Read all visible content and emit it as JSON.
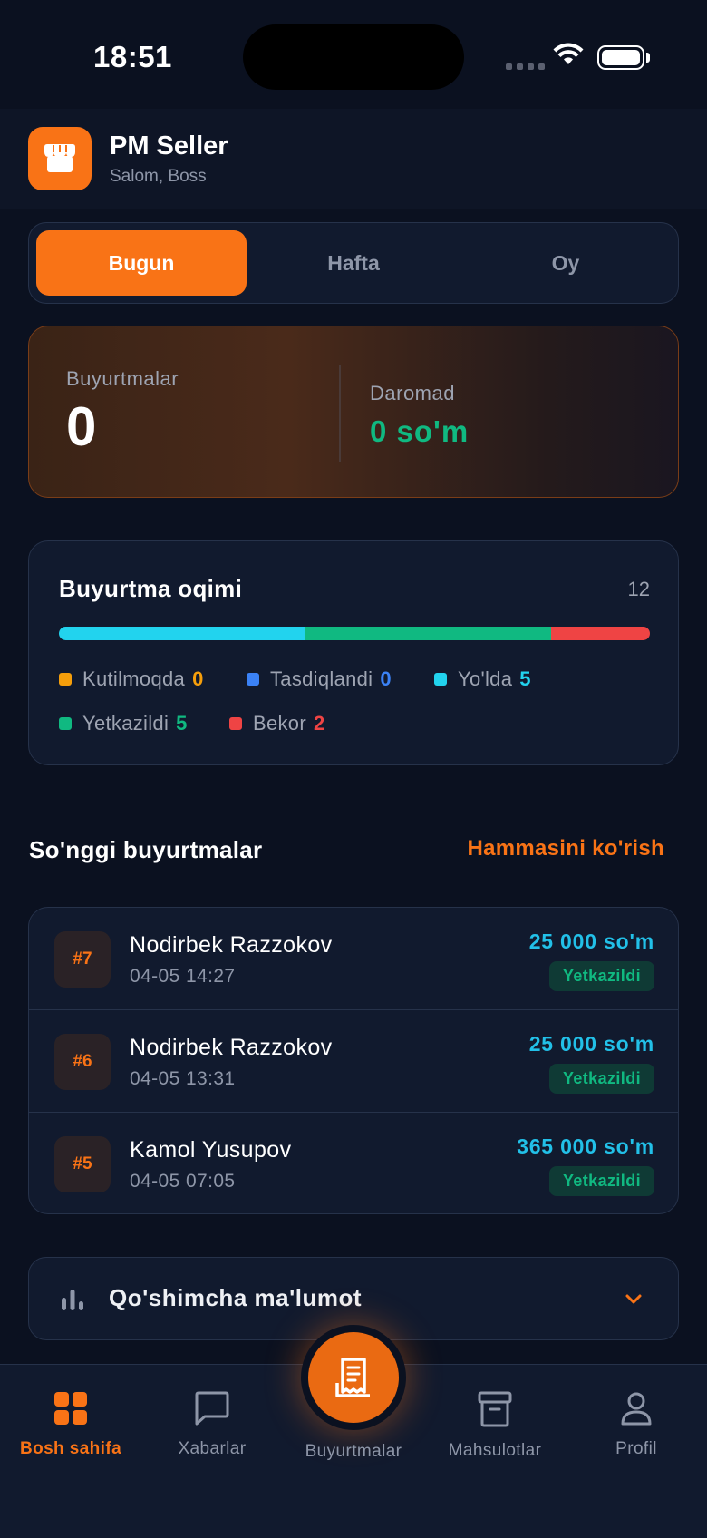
{
  "status_bar": {
    "time": "18:51"
  },
  "header": {
    "app_name": "PM Seller",
    "greeting": "Salom, Boss",
    "logo_icon": "store-icon"
  },
  "period_tabs": [
    {
      "label": "Bugun",
      "active": true
    },
    {
      "label": "Hafta",
      "active": false
    },
    {
      "label": "Oy",
      "active": false
    }
  ],
  "summary": {
    "orders_label": "Buyurtmalar",
    "orders_value": "0",
    "income_label": "Daromad",
    "income_value": "0 so'm"
  },
  "order_flow": {
    "title": "Buyurtma oqimi",
    "total": "12",
    "statuses": [
      {
        "label": "Kutilmoqda",
        "count": "0",
        "color": "#f59e0b"
      },
      {
        "label": "Tasdiqlandi",
        "count": "0",
        "color": "#3b82f6"
      },
      {
        "label": "Yo'lda",
        "count": "5",
        "color": "#22d3ee"
      },
      {
        "label": "Yetkazildi",
        "count": "5",
        "color": "#10b981"
      },
      {
        "label": "Bekor",
        "count": "2",
        "color": "#ef4444"
      }
    ]
  },
  "recent_orders": {
    "title": "So'nggi buyurtmalar",
    "see_all": "Hammasini ko'rish",
    "items": [
      {
        "id": "#7",
        "customer": "Nodirbek Razzokov",
        "date": "04-05 14:27",
        "amount": "25 000 so'm",
        "status": "Yetkazildi"
      },
      {
        "id": "#6",
        "customer": "Nodirbek Razzokov",
        "date": "04-05 13:31",
        "amount": "25 000 so'm",
        "status": "Yetkazildi"
      },
      {
        "id": "#5",
        "customer": "Kamol Yusupov",
        "date": "04-05 07:05",
        "amount": "365 000 so'm",
        "status": "Yetkazildi"
      }
    ]
  },
  "more_info": {
    "label": "Qo'shimcha ma'lumot",
    "icon": "bar-chart-icon"
  },
  "bottom_nav": {
    "items": [
      {
        "label": "Bosh sahifa",
        "icon": "grid-icon",
        "active": true
      },
      {
        "label": "Xabarlar",
        "icon": "message-icon",
        "active": false
      },
      {
        "label": "Buyurtmalar",
        "icon": "receipt-icon",
        "active": false
      },
      {
        "label": "Mahsulotlar",
        "icon": "archive-icon",
        "active": false
      },
      {
        "label": "Profil",
        "icon": "user-icon",
        "active": false
      }
    ]
  },
  "colors": {
    "accent": "#f97316",
    "background": "#0b1120",
    "card": "#111a2e",
    "success": "#10b981",
    "amount": "#22c0e8"
  }
}
